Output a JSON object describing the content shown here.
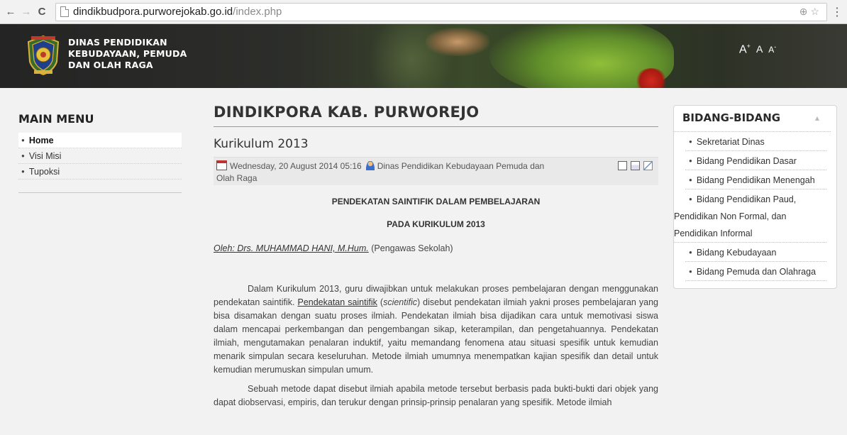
{
  "browser": {
    "url_host": "dindikbudpora.purworejokab.go.id",
    "url_path": "/index.php"
  },
  "header": {
    "title_line1": "DINAS PENDIDIKAN",
    "title_line2": "KEBUDAYAAN, PEMUDA",
    "title_line3": "DAN OLAH RAGA",
    "font_increase": "A",
    "font_increase_sup": "+",
    "font_reset": "A",
    "font_decrease": "A",
    "font_decrease_sup": "-"
  },
  "main_menu": {
    "heading": "MAIN MENU",
    "items": [
      {
        "label": "Home",
        "active": true
      },
      {
        "label": "Visi Misi",
        "active": false
      },
      {
        "label": "Tupoksi",
        "active": false
      }
    ]
  },
  "content": {
    "site_heading": "DINDIKPORA KAB. PURWOREJO",
    "article_title": "Kurikulum 2013",
    "meta_date": "Wednesday, 20 August 2014 05:16",
    "meta_author_line1": "Dinas Pendidikan Kebudayaan Pemuda dan",
    "meta_author_line2": "Olah Raga",
    "heading1": "PENDEKATAN SAINTIFIK DALAM PEMBELAJARAN",
    "heading2": "PADA KURIKULUM 2013",
    "author_link": "Oleh: Drs. MUHAMMAD HANI, M.Hum.",
    "author_suffix": " (Pengawas Sekolah)",
    "para1_a": "Dalam Kurikulum 2013, guru diwajibkan untuk melakukan proses pembelajaran dengan menggunakan pendekatan saintifik. ",
    "para1_link": "Pendekatan saintifik",
    "para1_b": " (",
    "para1_italic": "scientific",
    "para1_c": ") disebut pendekatan ilmiah yakni proses pembelajaran yang bisa disamakan dengan suatu proses ilmiah. Pendekatan ilmiah bisa dijadikan cara untuk memotivasi siswa dalam mencapai perkembangan dan pengembangan sikap, keterampilan, dan pengetahuannya. Pendekatan ilmiah, mengutamakan penalaran induktif, yaitu memandang fenomena atau situasi spesifik untuk kemudian menarik simpulan secara keseluruhan. Metode ilmiah umumnya menempatkan kajian spesifik dan detail untuk kemudian merumuskan simpulan umum.",
    "para2": "Sebuah metode dapat disebut ilmiah apabila metode tersebut berbasis pada bukti-bukti dari objek yang dapat diobservasi, empiris, dan terukur dengan prinsip-prinsip penalaran yang spesifik. Metode ilmiah"
  },
  "bidang": {
    "heading": "BIDANG-BIDANG",
    "items": [
      "Sekretariat Dinas",
      "Bidang Pendidikan Dasar",
      "Bidang Pendidikan Menengah",
      "Bidang Pendidikan Paud,",
      "Bidang Kebudayaan",
      "Bidang Pemuda dan Olahraga"
    ],
    "paud_line2": "Pendidikan Non Formal, dan",
    "paud_line3": "Pendidikan Informal"
  }
}
